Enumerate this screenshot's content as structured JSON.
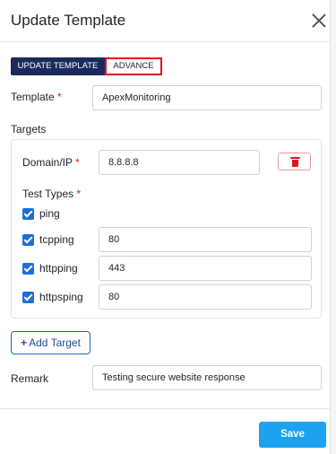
{
  "modal": {
    "title": "Update Template",
    "close_icon": "close-icon"
  },
  "tabs": {
    "update_template": "UPDATE TEMPLATE",
    "advance": "ADVANCE"
  },
  "template": {
    "label": "Template",
    "required": "*",
    "value": "ApexMonitoring"
  },
  "targets": {
    "heading": "Targets",
    "domain_label": "Domain/IP",
    "required": "*",
    "domain_value": "8.8.8.8",
    "delete_icon": "trash-icon",
    "test_types_label": "Test Types",
    "test_types": [
      {
        "name": "ping",
        "checked": true,
        "value": ""
      },
      {
        "name": "tcpping",
        "checked": true,
        "value": "80"
      },
      {
        "name": "httpping",
        "checked": true,
        "value": "443"
      },
      {
        "name": "httpsping",
        "checked": true,
        "value": "80"
      }
    ]
  },
  "add_target": {
    "icon": "+",
    "label": "Add Target"
  },
  "remark": {
    "label": "Remark",
    "value": "Testing secure website response"
  },
  "footer": {
    "save_label": "Save"
  },
  "colors": {
    "primary_dark": "#1b2a5c",
    "accent": "#1aa3ef",
    "required": "#e0141e",
    "checkbox": "#1e6fd9"
  }
}
